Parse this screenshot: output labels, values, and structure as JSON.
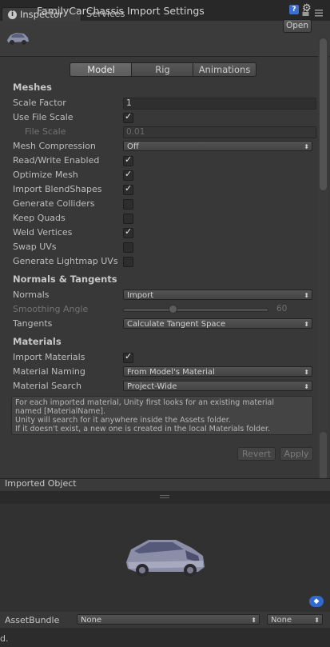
{
  "tabs": [
    {
      "label": "Inspector",
      "icon": "info-icon"
    },
    {
      "label": "Services"
    }
  ],
  "header": {
    "title": "FamilyCarChassis Import Settings",
    "open_label": "Open",
    "help_icon": "help-book-icon",
    "gear_icon": "gear-icon"
  },
  "segments": [
    "Model",
    "Rig",
    "Animations"
  ],
  "active_segment": "Model",
  "meshes": {
    "heading": "Meshes",
    "scale_factor": {
      "label": "Scale Factor",
      "value": "1"
    },
    "use_file_scale": {
      "label": "Use File Scale",
      "checked": true
    },
    "file_scale": {
      "label": "File Scale",
      "value": "0.01"
    },
    "mesh_compression": {
      "label": "Mesh Compression",
      "value": "Off"
    },
    "read_write": {
      "label": "Read/Write Enabled",
      "checked": true
    },
    "optimize_mesh": {
      "label": "Optimize Mesh",
      "checked": true
    },
    "import_blendshapes": {
      "label": "Import BlendShapes",
      "checked": true
    },
    "generate_colliders": {
      "label": "Generate Colliders",
      "checked": false
    },
    "keep_quads": {
      "label": "Keep Quads",
      "checked": false
    },
    "weld_vertices": {
      "label": "Weld Vertices",
      "checked": true
    },
    "swap_uvs": {
      "label": "Swap UVs",
      "checked": false
    },
    "generate_lightmap_uvs": {
      "label": "Generate Lightmap UVs",
      "checked": false
    }
  },
  "normals": {
    "heading": "Normals & Tangents",
    "normals": {
      "label": "Normals",
      "value": "Import"
    },
    "smoothing_angle": {
      "label": "Smoothing Angle",
      "value": "60",
      "fraction": 0.33
    },
    "tangents": {
      "label": "Tangents",
      "value": "Calculate Tangent Space"
    }
  },
  "materials": {
    "heading": "Materials",
    "import_materials": {
      "label": "Import Materials",
      "checked": true
    },
    "material_naming": {
      "label": "Material Naming",
      "value": "From Model's Material"
    },
    "material_search": {
      "label": "Material Search",
      "value": "Project-Wide"
    },
    "help_lines": [
      "For each imported material, Unity first looks for an existing material",
      "named [MaterialName].",
      "Unity will search for it anywhere inside the Assets folder.",
      "If it doesn't exist, a new one is created in the local Materials folder."
    ]
  },
  "buttons": {
    "revert": "Revert",
    "apply": "Apply"
  },
  "imported_object_label": "Imported Object",
  "assetbundle": {
    "label": "AssetBundle",
    "value1": "None",
    "value2": "None"
  },
  "bottom_text": "d.",
  "colors": {
    "background": "#383838",
    "accent": "#3d6fd1",
    "text": "#bdbdbd"
  }
}
